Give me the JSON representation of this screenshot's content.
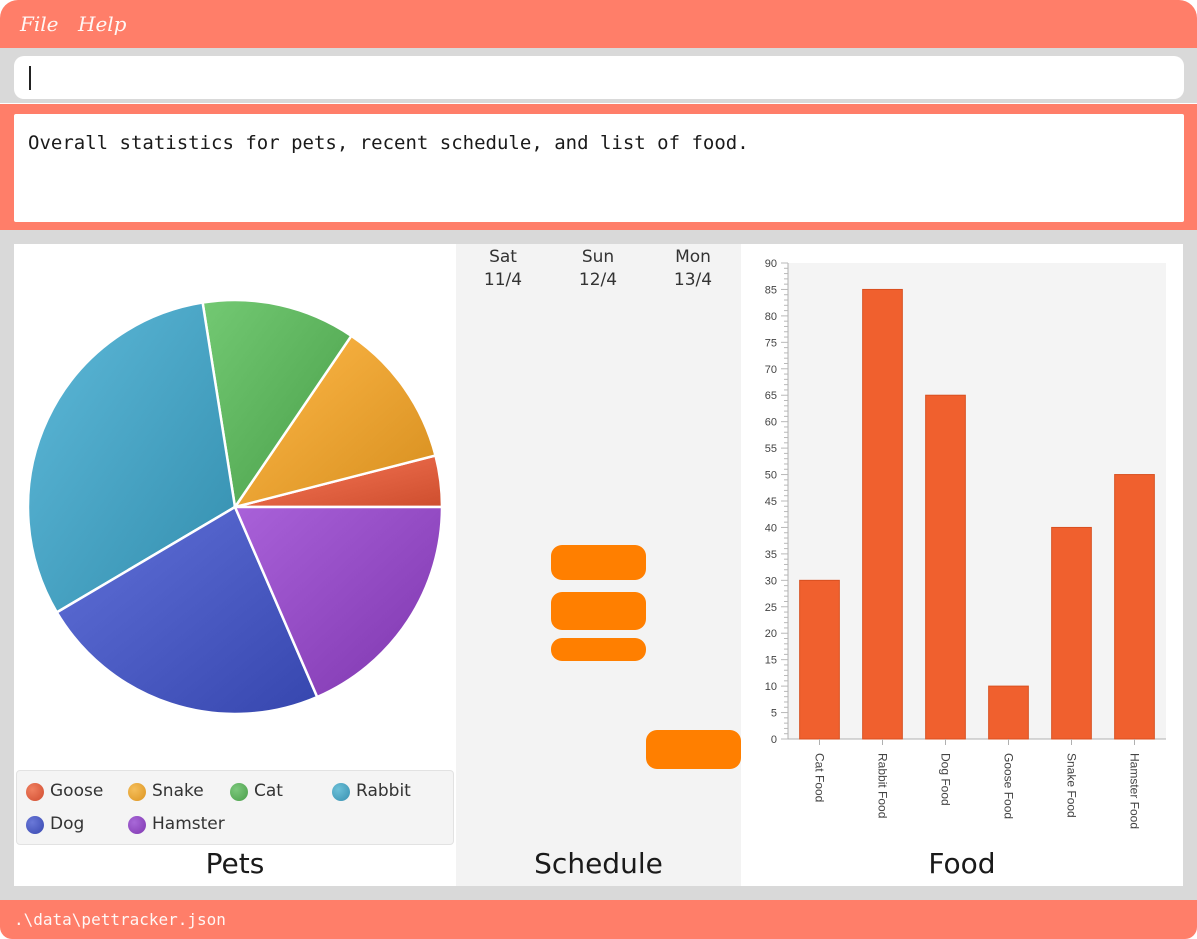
{
  "menu": {
    "file": "File",
    "help": "Help"
  },
  "command": {
    "value": "",
    "placeholder": ""
  },
  "result": {
    "text": "Overall statistics for pets, recent schedule, and list of food."
  },
  "pets": {
    "title": "Pets",
    "legend": [
      {
        "label": "Goose",
        "color": "#e06040"
      },
      {
        "label": "Snake",
        "color": "#e8a030"
      },
      {
        "label": "Cat",
        "color": "#5ab05a"
      },
      {
        "label": "Rabbit",
        "color": "#45a0c0"
      },
      {
        "label": "Dog",
        "color": "#4858c0"
      },
      {
        "label": "Hamster",
        "color": "#9048c0"
      }
    ]
  },
  "schedule": {
    "title": "Schedule",
    "days": [
      {
        "name": "Sat",
        "date": "11/4"
      },
      {
        "name": "Sun",
        "date": "12/4"
      },
      {
        "name": "Mon",
        "date": "13/4"
      }
    ]
  },
  "food": {
    "title": "Food"
  },
  "status": {
    "path": ".\\data\\pettracker.json"
  },
  "chart_data": [
    {
      "type": "pie",
      "slices": [
        {
          "label": "Goose",
          "value": 4,
          "color": "#e06040"
        },
        {
          "label": "Snake",
          "value": 11.5,
          "color": "#e8a030"
        },
        {
          "label": "Cat",
          "value": 12,
          "color": "#5ab05a"
        },
        {
          "label": "Rabbit",
          "value": 31,
          "color": "#45a0c0"
        },
        {
          "label": "Dog",
          "value": 23,
          "color": "#4858c0"
        },
        {
          "label": "Hamster",
          "value": 18.5,
          "color": "#9048c0"
        }
      ]
    },
    {
      "type": "bar",
      "categories": [
        "Cat Food",
        "Rabbit Food",
        "Dog Food",
        "Goose Food",
        "Snake Food",
        "Hamster Food"
      ],
      "values": [
        30,
        85,
        65,
        10,
        40,
        50
      ],
      "ylim": [
        0,
        90
      ],
      "ytick_step": 5,
      "bar_color": "#f0602e"
    }
  ]
}
